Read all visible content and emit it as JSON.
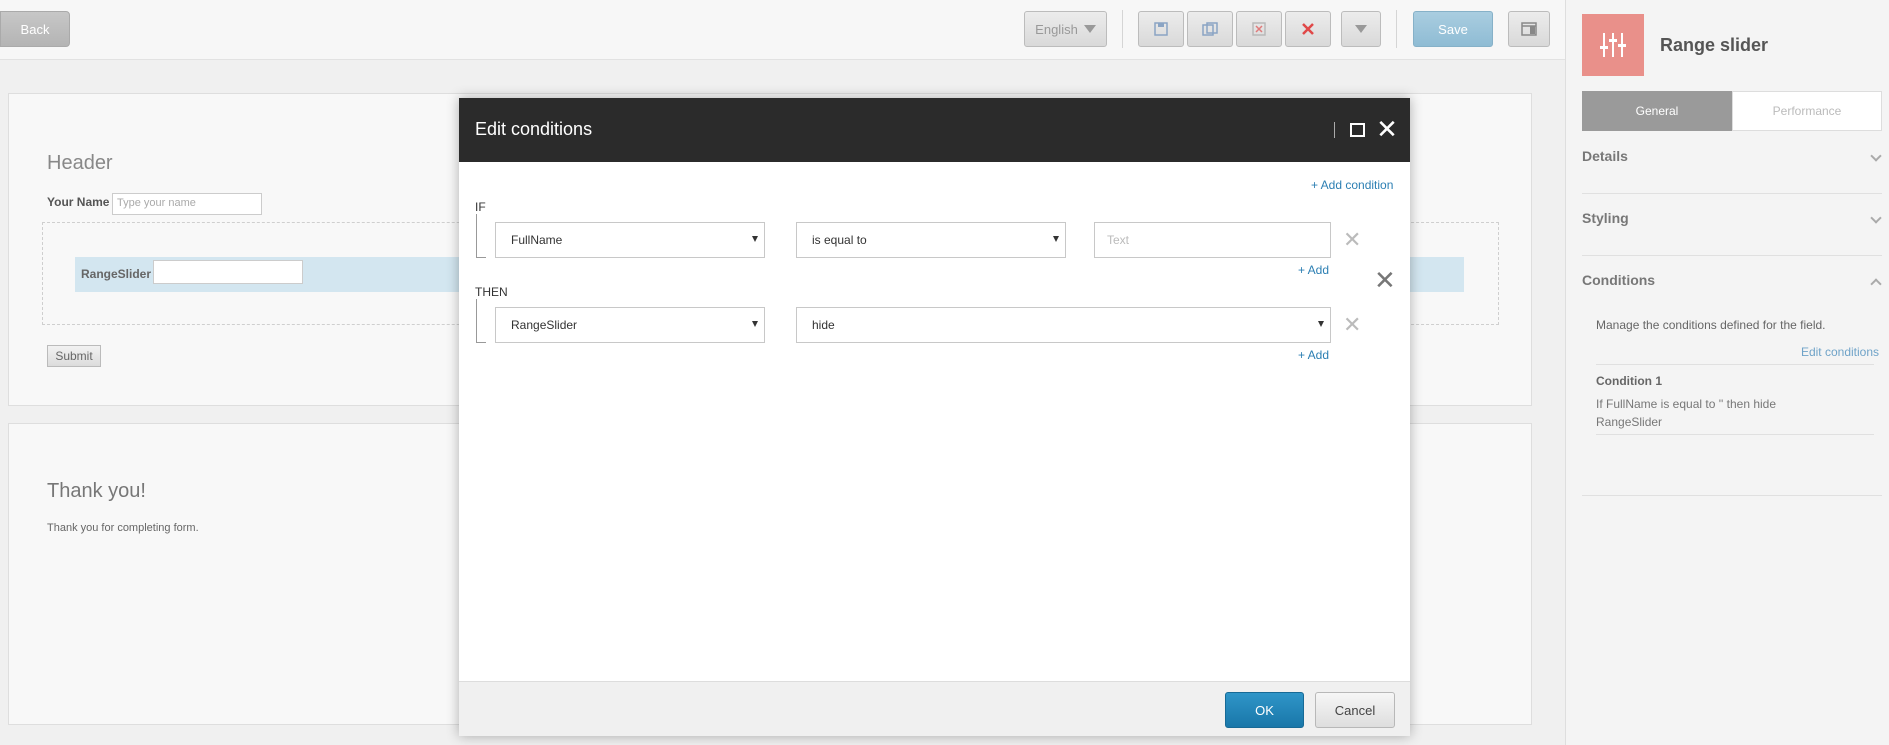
{
  "toolbar": {
    "back_label": "Back",
    "language": "English",
    "save_label": "Save",
    "icons": [
      "save-icon",
      "save-as-icon",
      "discard-icon",
      "delete-icon",
      "more-dropdown-icon",
      "layout-icon"
    ]
  },
  "form": {
    "header": "Header",
    "name_label": "Your Name",
    "name_placeholder": "Type your name",
    "slider_label": "RangeSlider",
    "submit_label": "Submit",
    "thanks_title": "Thank you!",
    "thanks_text": "Thank you for completing form."
  },
  "sidebar": {
    "title": "Range slider",
    "tabs": [
      "General",
      "Performance"
    ],
    "sections": [
      "Details",
      "Styling",
      "Conditions"
    ],
    "conditions_desc": "Manage the conditions defined for the field.",
    "edit_conditions": "Edit conditions",
    "condition_title": "Condition 1",
    "condition_text": "If FullName is equal to '' then hide RangeSlider"
  },
  "modal": {
    "title": "Edit conditions",
    "add_condition": "+ Add condition",
    "if_label": "IF",
    "then_label": "THEN",
    "if_field": "FullName",
    "if_operator": "is equal to",
    "if_value_placeholder": "Text",
    "then_field": "RangeSlider",
    "then_action": "hide",
    "add_label": "+ Add",
    "ok_label": "OK",
    "cancel_label": "Cancel"
  }
}
